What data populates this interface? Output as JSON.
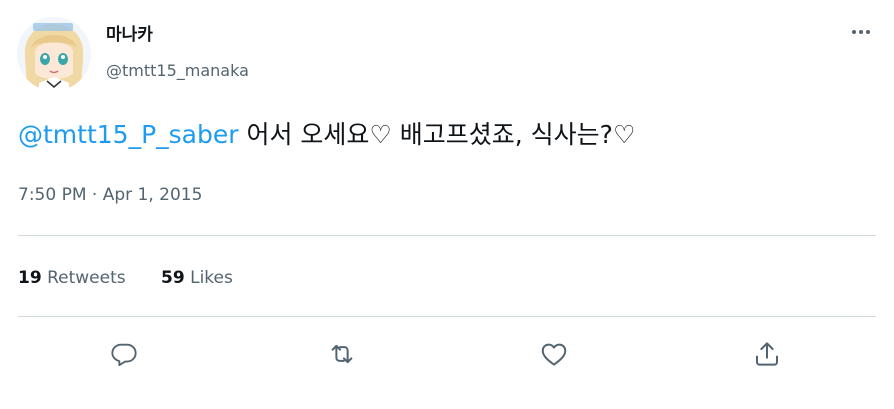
{
  "author": {
    "display_name": "마나카",
    "handle": "@tmtt15_manaka"
  },
  "tweet": {
    "mention": "@tmtt15_P_saber",
    "text": " 어서 오세요♡ 배고프셨죠, 식사는?♡"
  },
  "timestamp": "7:50 PM · Apr 1, 2015",
  "stats": {
    "retweets_count": "19",
    "retweets_label": "Retweets",
    "likes_count": "59",
    "likes_label": "Likes"
  },
  "icons": {
    "reply": "reply-icon",
    "retweet": "retweet-icon",
    "like": "heart-icon",
    "share": "share-icon",
    "more": "more-icon"
  },
  "colors": {
    "accent": "#1d9bf0",
    "text_primary": "#0f1419",
    "text_secondary": "#536471",
    "divider": "#cfd9de"
  }
}
